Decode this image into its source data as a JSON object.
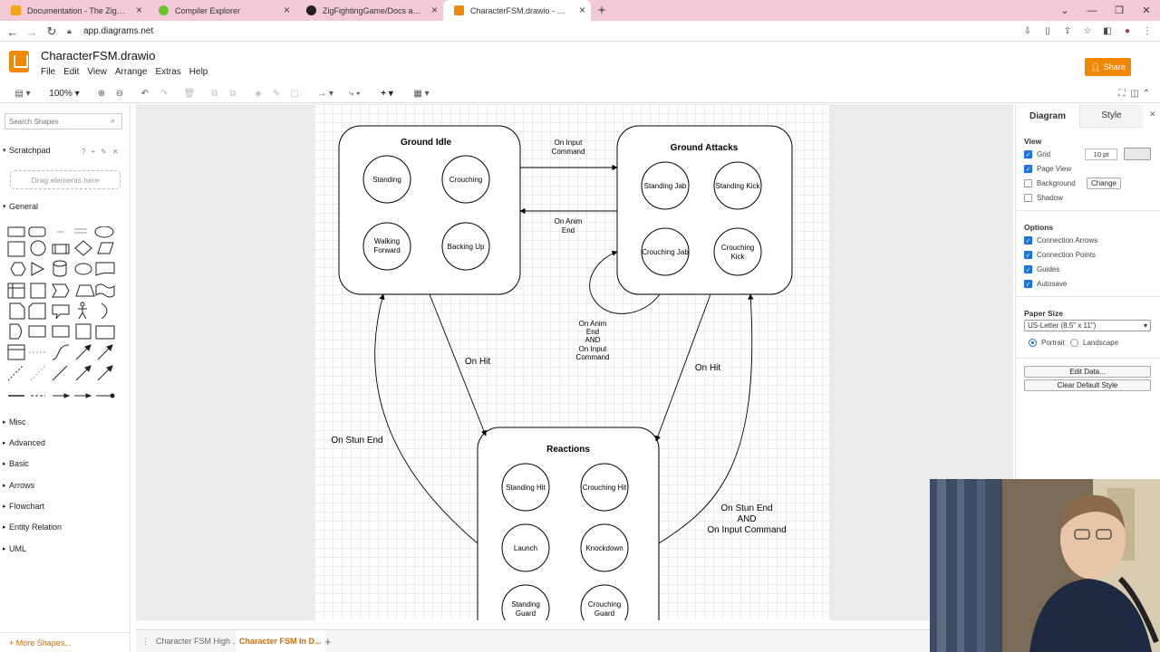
{
  "browser": {
    "tabs": [
      {
        "title": "Documentation - The Zig Programming Language",
        "favicon_color": "#f7a41d",
        "active": false
      },
      {
        "title": "Compiler Explorer",
        "favicon_color": "#67c52a",
        "active": false
      },
      {
        "title": "ZigFightingGame/Docs at main",
        "favicon_color": "#222222",
        "active": false
      },
      {
        "title": "CharacterFSM.drawio - diagrams.net",
        "favicon_color": "#f08705",
        "active": true
      }
    ],
    "url": "app.diagrams.net"
  },
  "app": {
    "doc_title": "CharacterFSM.drawio",
    "menu": [
      "File",
      "Edit",
      "View",
      "Arrange",
      "Extras",
      "Help"
    ],
    "share_label": "Share",
    "zoom": "100%",
    "accent": "#f08705"
  },
  "sidebar": {
    "search_placeholder": "Search Shapes",
    "scratchpad_label": "Scratchpad",
    "drag_hint": "Drag elements here",
    "general_label": "General",
    "sections": [
      "Misc",
      "Advanced",
      "Basic",
      "Arrows",
      "Flowchart",
      "Entity Relation",
      "UML"
    ],
    "more_shapes": "More Shapes..."
  },
  "diagram": {
    "groups": {
      "ground_idle": {
        "title": "Ground Idle",
        "states": [
          "Standing",
          "Crouching",
          "Walking Forward",
          "Backing Up"
        ]
      },
      "ground_attacks": {
        "title": "Ground Attacks",
        "states": [
          "Standing Jab",
          "Standing Kick",
          "Crouching Jab",
          "Crouching Kick"
        ]
      },
      "reactions": {
        "title": "Reactions",
        "states": [
          "Standing Hit",
          "Crouching Hit",
          "Launch",
          "Knockdown",
          "Standing Guard",
          "Crouching Guard"
        ]
      }
    },
    "transitions": {
      "on_input_command": [
        "On Input",
        "Command"
      ],
      "on_anim_end": [
        "On Anim",
        "End"
      ],
      "on_anim_end_and_input": [
        "On Anim",
        "End",
        "AND",
        "On Input",
        "Command"
      ],
      "on_hit_left": "On Hit",
      "on_hit_right": "On Hit",
      "on_stun_end": "On Stun End",
      "on_stun_end_and_input": [
        "On Stun End",
        "AND",
        "On Input Command"
      ]
    }
  },
  "bottom_tabs": {
    "tab1": "Character FSM High ...",
    "tab2": "Character FSM In D..."
  },
  "format_panel": {
    "tab_diagram": "Diagram",
    "tab_style": "Style",
    "view_heading": "View",
    "grid_label": "Grid",
    "grid_size": "10 pt",
    "page_view_label": "Page View",
    "background_label": "Background",
    "change_label": "Change",
    "shadow_label": "Shadow",
    "options_heading": "Options",
    "connection_arrows": "Connection Arrows",
    "connection_points": "Connection Points",
    "guides": "Guides",
    "autosave": "Autosave",
    "paper_heading": "Paper Size",
    "paper_size": "US-Letter (8.5\" x 11\")",
    "portrait": "Portrait",
    "landscape": "Landscape",
    "edit_data": "Edit Data...",
    "clear_style": "Clear Default Style"
  }
}
